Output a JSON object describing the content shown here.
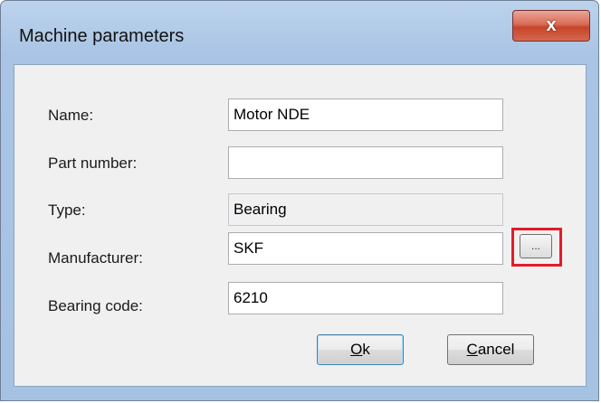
{
  "window": {
    "title": "Machine parameters",
    "close_glyph": "x"
  },
  "form": {
    "name_label": "Name:",
    "name_value": "Motor NDE",
    "part_number_label": "Part number:",
    "part_number_value": "",
    "type_label": "Type:",
    "type_value": "Bearing",
    "manufacturer_label": "Manufacturer:",
    "manufacturer_value": "SKF",
    "browse_label": "...",
    "bearing_code_label": "Bearing code:",
    "bearing_code_value": "6210"
  },
  "buttons": {
    "ok_accel": "O",
    "ok_rest": "k",
    "cancel_accel": "C",
    "cancel_rest": "ancel"
  },
  "colors": {
    "highlight": "#e21b2b",
    "title_bar": "#a9c4e4",
    "close_button": "#c8442a"
  }
}
